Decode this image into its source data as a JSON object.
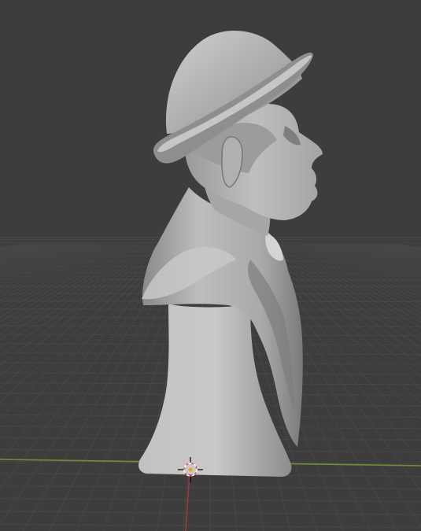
{
  "viewport": {
    "background_color": "#3d3d3d",
    "grid_line_color": "#474747",
    "x_axis_color": "#6e8f3a",
    "y_axis_color": "#9a3a42",
    "model_base_color": "#b4b4b4",
    "model_shadow_color": "#6a6a6a",
    "model_highlight_color": "#d2d2d2"
  },
  "scene": {
    "object": "sculpted-bust-with-bowler-hat",
    "view": "side-profile",
    "shading": "solid",
    "cursor_icon": "3d-cursor-icon"
  }
}
